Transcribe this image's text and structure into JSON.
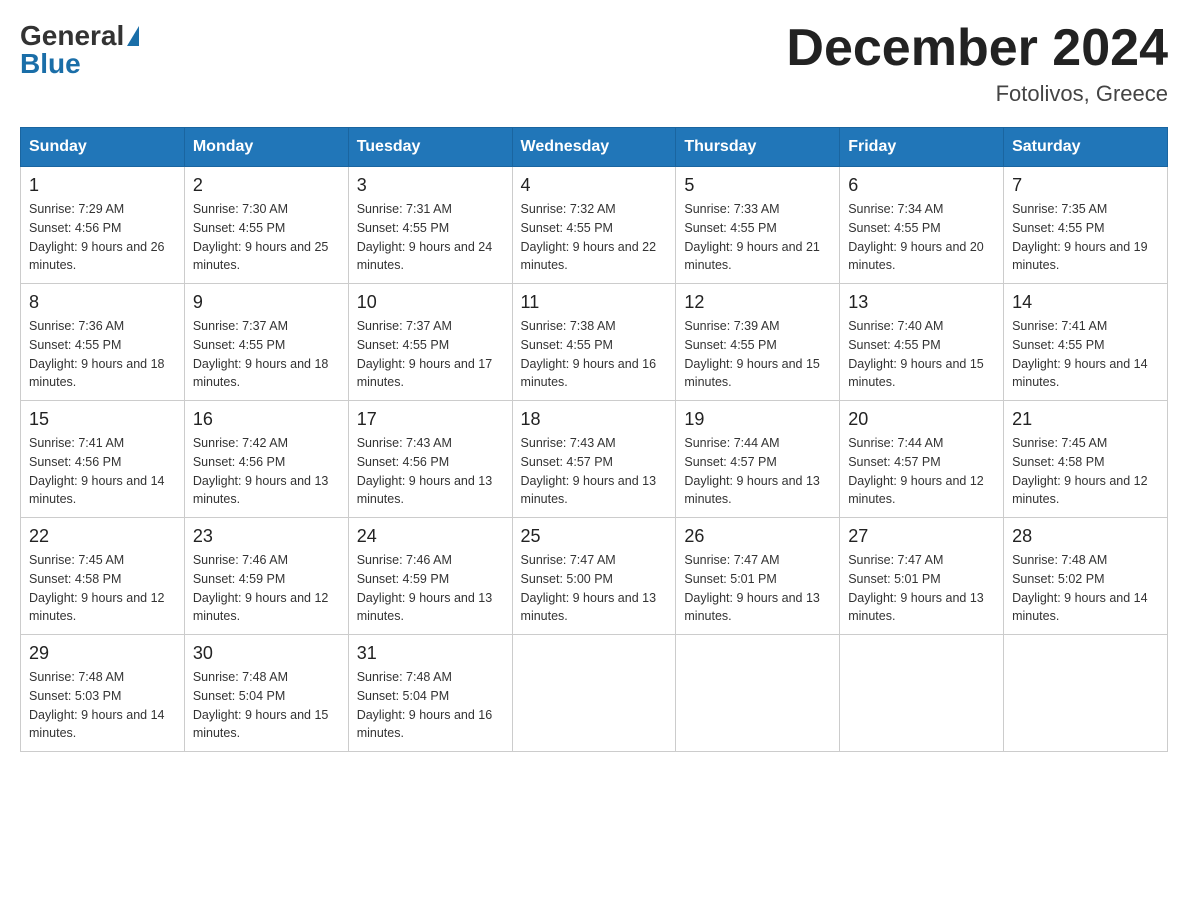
{
  "header": {
    "logo_general": "General",
    "logo_blue": "Blue",
    "month_title": "December 2024",
    "location": "Fotolivos, Greece"
  },
  "days_of_week": [
    "Sunday",
    "Monday",
    "Tuesday",
    "Wednesday",
    "Thursday",
    "Friday",
    "Saturday"
  ],
  "weeks": [
    [
      {
        "day": "1",
        "sunrise": "Sunrise: 7:29 AM",
        "sunset": "Sunset: 4:56 PM",
        "daylight": "Daylight: 9 hours and 26 minutes."
      },
      {
        "day": "2",
        "sunrise": "Sunrise: 7:30 AM",
        "sunset": "Sunset: 4:55 PM",
        "daylight": "Daylight: 9 hours and 25 minutes."
      },
      {
        "day": "3",
        "sunrise": "Sunrise: 7:31 AM",
        "sunset": "Sunset: 4:55 PM",
        "daylight": "Daylight: 9 hours and 24 minutes."
      },
      {
        "day": "4",
        "sunrise": "Sunrise: 7:32 AM",
        "sunset": "Sunset: 4:55 PM",
        "daylight": "Daylight: 9 hours and 22 minutes."
      },
      {
        "day": "5",
        "sunrise": "Sunrise: 7:33 AM",
        "sunset": "Sunset: 4:55 PM",
        "daylight": "Daylight: 9 hours and 21 minutes."
      },
      {
        "day": "6",
        "sunrise": "Sunrise: 7:34 AM",
        "sunset": "Sunset: 4:55 PM",
        "daylight": "Daylight: 9 hours and 20 minutes."
      },
      {
        "day": "7",
        "sunrise": "Sunrise: 7:35 AM",
        "sunset": "Sunset: 4:55 PM",
        "daylight": "Daylight: 9 hours and 19 minutes."
      }
    ],
    [
      {
        "day": "8",
        "sunrise": "Sunrise: 7:36 AM",
        "sunset": "Sunset: 4:55 PM",
        "daylight": "Daylight: 9 hours and 18 minutes."
      },
      {
        "day": "9",
        "sunrise": "Sunrise: 7:37 AM",
        "sunset": "Sunset: 4:55 PM",
        "daylight": "Daylight: 9 hours and 18 minutes."
      },
      {
        "day": "10",
        "sunrise": "Sunrise: 7:37 AM",
        "sunset": "Sunset: 4:55 PM",
        "daylight": "Daylight: 9 hours and 17 minutes."
      },
      {
        "day": "11",
        "sunrise": "Sunrise: 7:38 AM",
        "sunset": "Sunset: 4:55 PM",
        "daylight": "Daylight: 9 hours and 16 minutes."
      },
      {
        "day": "12",
        "sunrise": "Sunrise: 7:39 AM",
        "sunset": "Sunset: 4:55 PM",
        "daylight": "Daylight: 9 hours and 15 minutes."
      },
      {
        "day": "13",
        "sunrise": "Sunrise: 7:40 AM",
        "sunset": "Sunset: 4:55 PM",
        "daylight": "Daylight: 9 hours and 15 minutes."
      },
      {
        "day": "14",
        "sunrise": "Sunrise: 7:41 AM",
        "sunset": "Sunset: 4:55 PM",
        "daylight": "Daylight: 9 hours and 14 minutes."
      }
    ],
    [
      {
        "day": "15",
        "sunrise": "Sunrise: 7:41 AM",
        "sunset": "Sunset: 4:56 PM",
        "daylight": "Daylight: 9 hours and 14 minutes."
      },
      {
        "day": "16",
        "sunrise": "Sunrise: 7:42 AM",
        "sunset": "Sunset: 4:56 PM",
        "daylight": "Daylight: 9 hours and 13 minutes."
      },
      {
        "day": "17",
        "sunrise": "Sunrise: 7:43 AM",
        "sunset": "Sunset: 4:56 PM",
        "daylight": "Daylight: 9 hours and 13 minutes."
      },
      {
        "day": "18",
        "sunrise": "Sunrise: 7:43 AM",
        "sunset": "Sunset: 4:57 PM",
        "daylight": "Daylight: 9 hours and 13 minutes."
      },
      {
        "day": "19",
        "sunrise": "Sunrise: 7:44 AM",
        "sunset": "Sunset: 4:57 PM",
        "daylight": "Daylight: 9 hours and 13 minutes."
      },
      {
        "day": "20",
        "sunrise": "Sunrise: 7:44 AM",
        "sunset": "Sunset: 4:57 PM",
        "daylight": "Daylight: 9 hours and 12 minutes."
      },
      {
        "day": "21",
        "sunrise": "Sunrise: 7:45 AM",
        "sunset": "Sunset: 4:58 PM",
        "daylight": "Daylight: 9 hours and 12 minutes."
      }
    ],
    [
      {
        "day": "22",
        "sunrise": "Sunrise: 7:45 AM",
        "sunset": "Sunset: 4:58 PM",
        "daylight": "Daylight: 9 hours and 12 minutes."
      },
      {
        "day": "23",
        "sunrise": "Sunrise: 7:46 AM",
        "sunset": "Sunset: 4:59 PM",
        "daylight": "Daylight: 9 hours and 12 minutes."
      },
      {
        "day": "24",
        "sunrise": "Sunrise: 7:46 AM",
        "sunset": "Sunset: 4:59 PM",
        "daylight": "Daylight: 9 hours and 13 minutes."
      },
      {
        "day": "25",
        "sunrise": "Sunrise: 7:47 AM",
        "sunset": "Sunset: 5:00 PM",
        "daylight": "Daylight: 9 hours and 13 minutes."
      },
      {
        "day": "26",
        "sunrise": "Sunrise: 7:47 AM",
        "sunset": "Sunset: 5:01 PM",
        "daylight": "Daylight: 9 hours and 13 minutes."
      },
      {
        "day": "27",
        "sunrise": "Sunrise: 7:47 AM",
        "sunset": "Sunset: 5:01 PM",
        "daylight": "Daylight: 9 hours and 13 minutes."
      },
      {
        "day": "28",
        "sunrise": "Sunrise: 7:48 AM",
        "sunset": "Sunset: 5:02 PM",
        "daylight": "Daylight: 9 hours and 14 minutes."
      }
    ],
    [
      {
        "day": "29",
        "sunrise": "Sunrise: 7:48 AM",
        "sunset": "Sunset: 5:03 PM",
        "daylight": "Daylight: 9 hours and 14 minutes."
      },
      {
        "day": "30",
        "sunrise": "Sunrise: 7:48 AM",
        "sunset": "Sunset: 5:04 PM",
        "daylight": "Daylight: 9 hours and 15 minutes."
      },
      {
        "day": "31",
        "sunrise": "Sunrise: 7:48 AM",
        "sunset": "Sunset: 5:04 PM",
        "daylight": "Daylight: 9 hours and 16 minutes."
      },
      null,
      null,
      null,
      null
    ]
  ]
}
